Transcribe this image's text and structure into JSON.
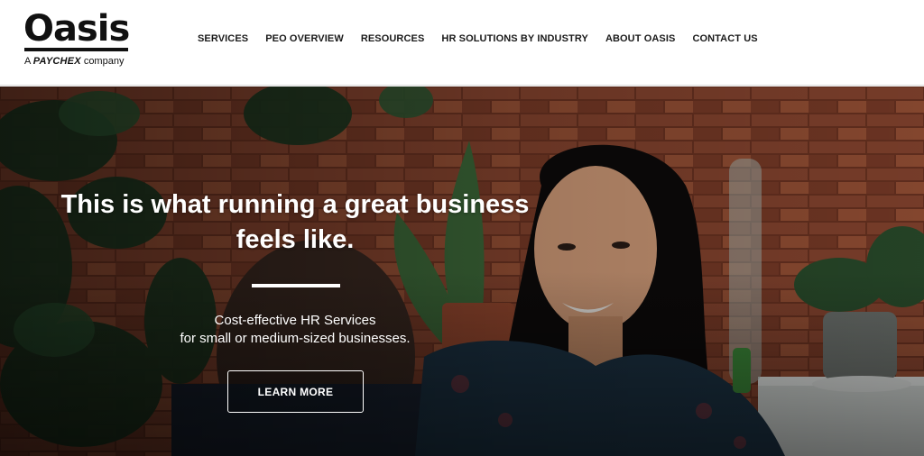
{
  "brand": {
    "logo_text": "Oasis",
    "tagline_prefix": "A",
    "tagline_brand": "PAYCHEX",
    "tagline_suffix": "company"
  },
  "nav": {
    "items": [
      {
        "label": "SERVICES"
      },
      {
        "label": "PEO OVERVIEW"
      },
      {
        "label": "RESOURCES"
      },
      {
        "label": "HR SOLUTIONS BY INDUSTRY"
      },
      {
        "label": "ABOUT OASIS"
      },
      {
        "label": "CONTACT US"
      }
    ]
  },
  "hero": {
    "title_line1": "This is what running a great business",
    "title_line2": "feels like.",
    "subtitle_line1": "Cost-effective HR Services",
    "subtitle_line2": "for small or medium-sized businesses.",
    "cta_label": "LEARN MORE"
  },
  "colors": {
    "brand_black": "#111111",
    "hero_text": "#ffffff",
    "brick": "#7a3d28"
  }
}
